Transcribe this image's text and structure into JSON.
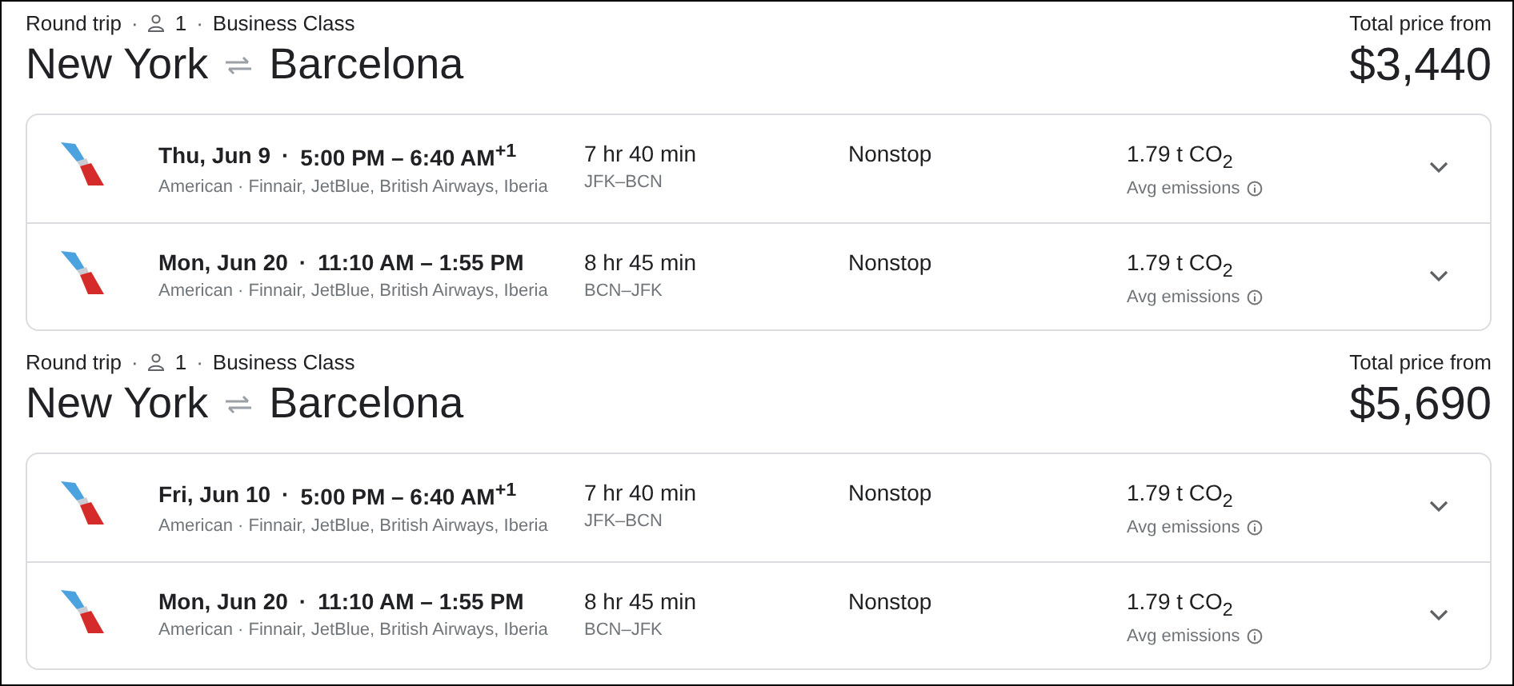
{
  "trips": [
    {
      "trip_type": "Round trip",
      "separator": "·",
      "passengers": "1",
      "cabin": "Business Class",
      "origin": "New York",
      "destination": "Barcelona",
      "price_label": "Total price from",
      "price": "$3,440",
      "flights": [
        {
          "date": "Thu, Jun 9",
          "times": "5:00 PM – 6:40 AM$^{+1}$",
          "airlines": "American · Finnair, JetBlue, British Airways, Iberia",
          "duration": "7 hr 40 min",
          "route": "JFK–BCN",
          "stops": "Nonstop",
          "emissions": "1.79 t CO$_{2}$",
          "emissions_label": "Avg emissions"
        },
        {
          "date": "Mon, Jun 20",
          "times": "11:10 AM – 1:55 PM",
          "airlines": "American · Finnair, JetBlue, British Airways, Iberia",
          "duration": "8 hr 45 min",
          "route": "BCN–JFK",
          "stops": "Nonstop",
          "emissions": "1.79 t CO$_{2}$",
          "emissions_label": "Avg emissions"
        }
      ]
    },
    {
      "trip_type": "Round trip",
      "separator": "·",
      "passengers": "1",
      "cabin": "Business Class",
      "origin": "New York",
      "destination": "Barcelona",
      "price_label": "Total price from",
      "price": "$5,690",
      "flights": [
        {
          "date": "Fri, Jun 10",
          "times": "5:00 PM – 6:40 AM$^{+1}$",
          "airlines": "American · Finnair, JetBlue, British Airways, Iberia",
          "duration": "7 hr 40 min",
          "route": "JFK–BCN",
          "stops": "Nonstop",
          "emissions": "1.79 t CO$_{2}$",
          "emissions_label": "Avg emissions"
        },
        {
          "date": "Mon, Jun 20",
          "times": "11:10 AM – 1:55 PM",
          "airlines": "American · Finnair, JetBlue, British Airways, Iberia",
          "duration": "8 hr 45 min",
          "route": "BCN–JFK",
          "stops": "Nonstop",
          "emissions": "1.79 t CO$_{2}$",
          "emissions_label": "Avg emissions"
        }
      ]
    }
  ]
}
